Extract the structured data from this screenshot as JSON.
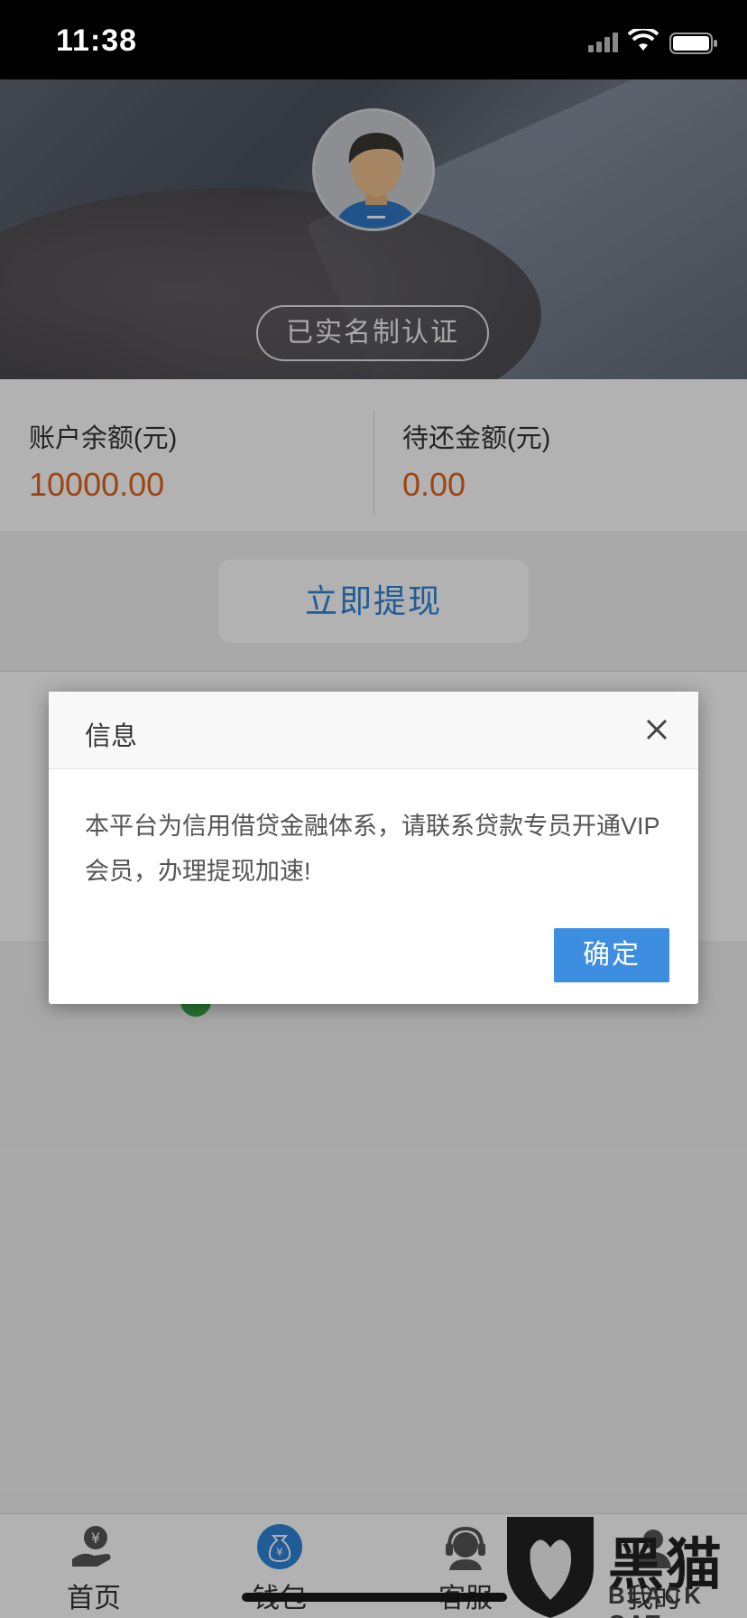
{
  "status_bar": {
    "time": "11:38"
  },
  "profile": {
    "verify_badge": "已实名制认证"
  },
  "account": {
    "balance_label": "账户余额(元)",
    "balance_value": "10000.00",
    "due_label": "待还金额(元)",
    "due_value": "0.00"
  },
  "withdraw_button": "立即提现",
  "dialog": {
    "title": "信息",
    "message": "本平台为信用借贷金融体系，请联系贷款专员开通VIP会员，办理提现加速!",
    "ok_label": "确定"
  },
  "tabs": [
    {
      "label": "首页",
      "icon": "home-yen-icon"
    },
    {
      "label": "钱包",
      "icon": "wallet-bag-icon"
    },
    {
      "label": "客服",
      "icon": "service-headset-icon"
    },
    {
      "label": "我的",
      "icon": "profile-icon"
    }
  ],
  "watermark": {
    "text": "黑猫",
    "sub": "BLACK CAT"
  },
  "colors": {
    "accent": "#3d8de1",
    "amount": "#e1651a",
    "link": "#2e85d8",
    "safe": "#39a64a"
  }
}
